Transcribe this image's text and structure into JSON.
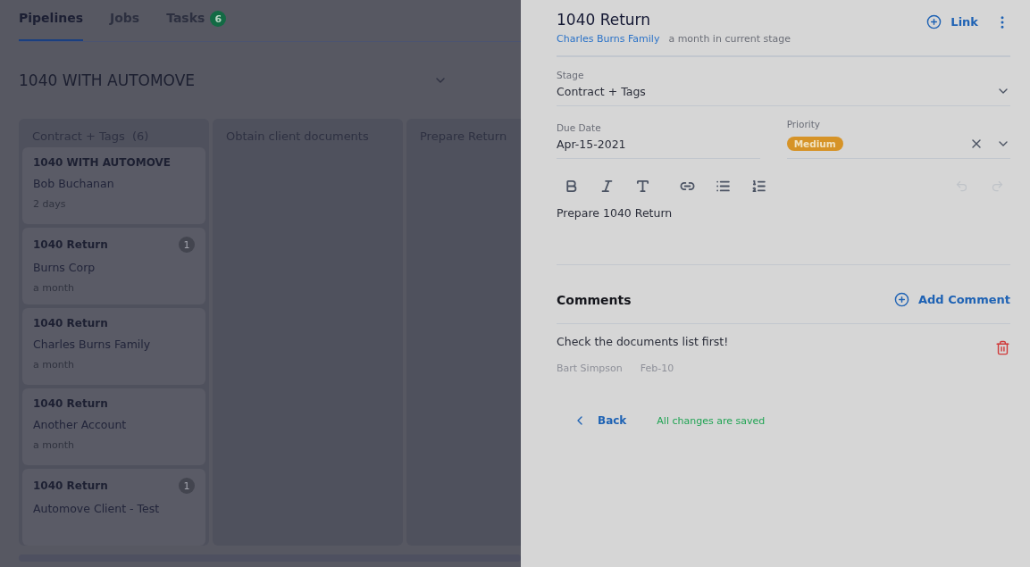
{
  "tabs": [
    {
      "label": "Pipelines",
      "selected": true
    },
    {
      "label": "Jobs",
      "selected": false
    },
    {
      "label": "Tasks",
      "selected": false,
      "badge": "6"
    }
  ],
  "pipeline": {
    "title": "1040 WITH AUTOMOVE"
  },
  "columns": [
    {
      "title": "Contract + Tags",
      "count": "(6)",
      "cards": [
        {
          "title": "1040 WITH AUTOMOVE",
          "client": "Bob Buchanan",
          "age": "2 days"
        },
        {
          "title": "1040 Return",
          "client": "Burns Corp",
          "age": "a month",
          "badge": "1"
        },
        {
          "title": "1040 Return",
          "client": "Charles Burns Family",
          "age": "a month"
        },
        {
          "title": "1040 Return",
          "client": "Another Account",
          "age": "a month"
        },
        {
          "title": "1040 Return",
          "client": "Automove Client - Test",
          "badge": "1"
        }
      ]
    },
    {
      "title": "Obtain client documents"
    },
    {
      "title": "Prepare Return"
    }
  ],
  "detail": {
    "title": "1040 Return",
    "client": "Charles Burns Family",
    "stage_age": "a month in current stage",
    "link": "Link",
    "stage": {
      "label": "Stage",
      "value": "Contract + Tags"
    },
    "due_date": {
      "label": "Due Date",
      "value": "Apr-15-2021"
    },
    "priority": {
      "label": "Priority",
      "value": "Medium",
      "color": "#d69327"
    },
    "description": "Prepare 1040 Return",
    "comments_title": "Comments",
    "add_comment": "Add Comment",
    "comments": [
      {
        "text": "Check the documents list first!",
        "author": "Bart Simpson",
        "date": "Feb-10"
      }
    ],
    "back": "Back",
    "status": "All changes are saved"
  }
}
